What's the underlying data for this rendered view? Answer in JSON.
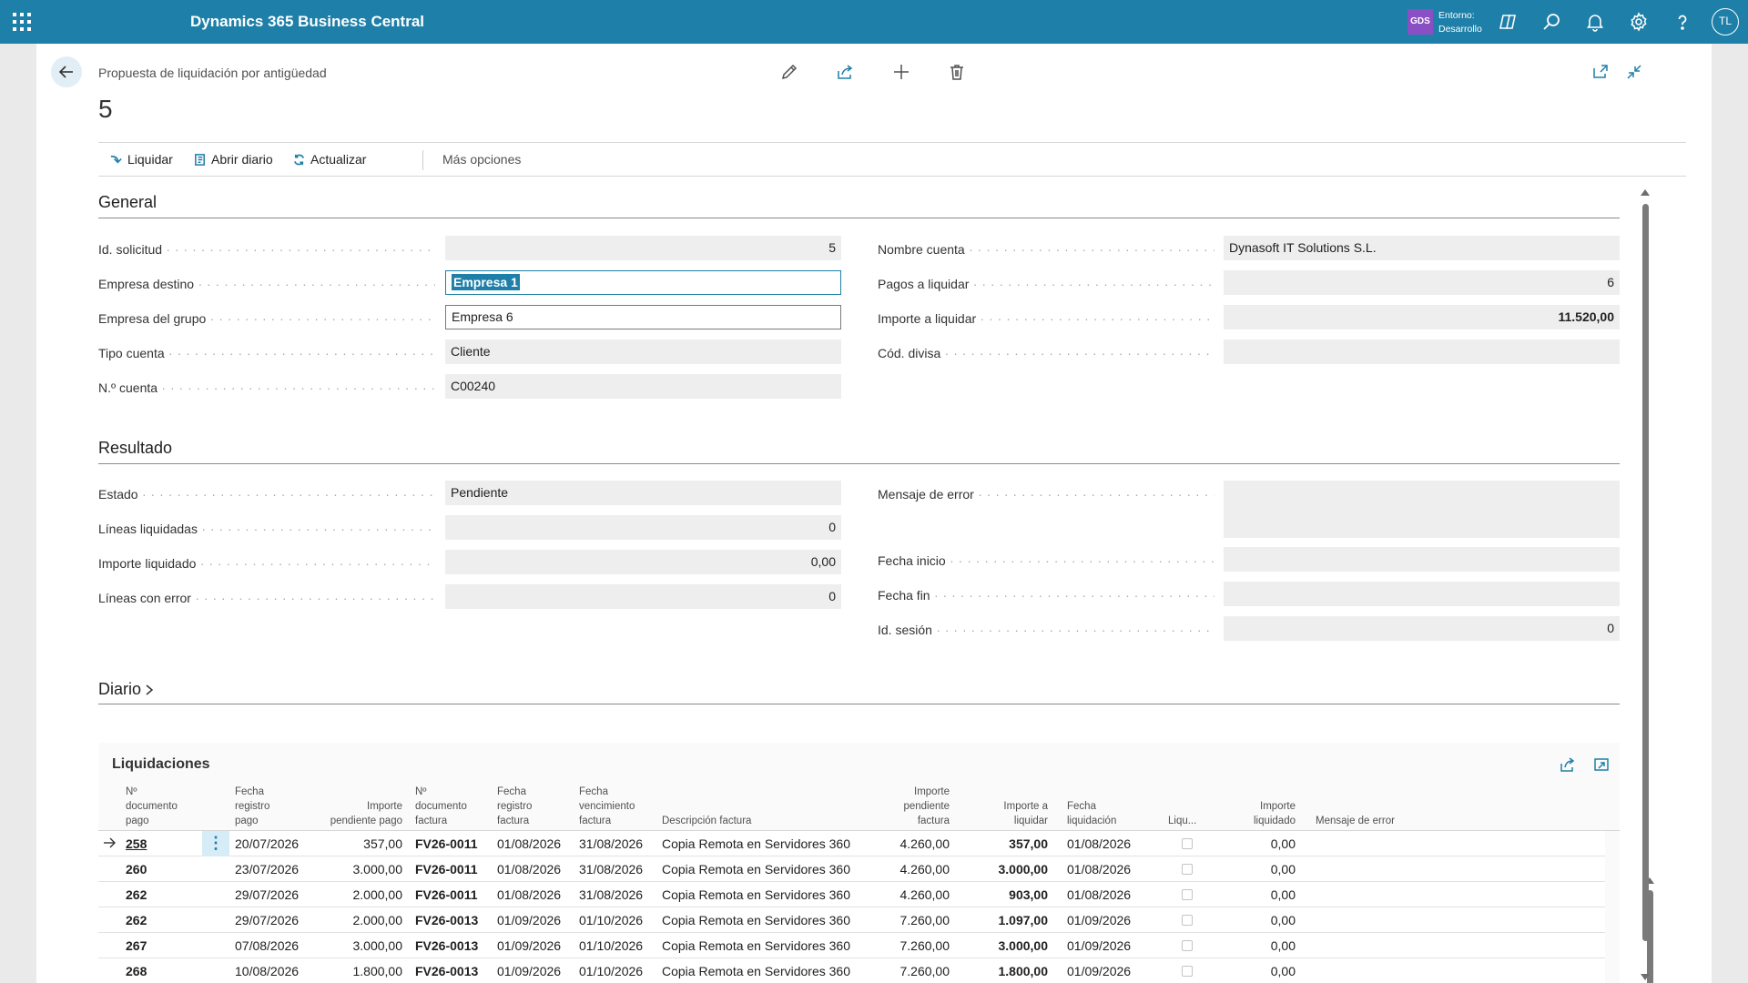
{
  "topbar": {
    "app_name": "Dynamics 365 Business Central",
    "env_badge": "GDS",
    "env_line1": "Entorno:",
    "env_line2": "Desarrollo",
    "user_initials": "TL"
  },
  "header": {
    "subtitle": "Propuesta de liquidación por antigüedad",
    "record_no": "5"
  },
  "actions": {
    "liquidar": "Liquidar",
    "abrir_diario": "Abrir diario",
    "actualizar": "Actualizar",
    "mas_opciones": "Más opciones"
  },
  "general": {
    "title": "General",
    "left": [
      {
        "label": "Id. solicitud",
        "value": "5"
      },
      {
        "label": "Empresa destino",
        "value": "Empresa 1"
      },
      {
        "label": "Empresa del grupo",
        "value": "Empresa 6"
      },
      {
        "label": "Tipo cuenta",
        "value": "Cliente"
      },
      {
        "label": "N.º cuenta",
        "value": "C00240"
      }
    ],
    "right": [
      {
        "label": "Nombre cuenta",
        "value": "Dynasoft IT Solutions S.L."
      },
      {
        "label": "Pagos a liquidar",
        "value": "6"
      },
      {
        "label": "Importe a liquidar",
        "value": "11.520,00"
      },
      {
        "label": "Cód. divisa",
        "value": ""
      }
    ]
  },
  "resultado": {
    "title": "Resultado",
    "left": [
      {
        "label": "Estado",
        "value": "Pendiente"
      },
      {
        "label": "Líneas liquidadas",
        "value": "0"
      },
      {
        "label": "Importe liquidado",
        "value": "0,00"
      },
      {
        "label": "Líneas con error",
        "value": "0"
      }
    ],
    "right": [
      {
        "label": "Mensaje de error",
        "value": ""
      },
      {
        "label": "Fecha inicio",
        "value": ""
      },
      {
        "label": "Fecha fin",
        "value": ""
      },
      {
        "label": "Id. sesión",
        "value": "0"
      }
    ]
  },
  "diario": {
    "title": "Diario"
  },
  "liquidaciones": {
    "title": "Liquidaciones",
    "columns": {
      "doc_pago": [
        "Nº",
        "documento",
        "pago"
      ],
      "fecha_reg_pago": [
        "Fecha",
        "registro",
        "pago"
      ],
      "importe_pend_pago": [
        "Importe",
        "pendiente pago"
      ],
      "doc_factura": [
        "Nº",
        "documento",
        "factura"
      ],
      "fecha_reg_factura": [
        "Fecha",
        "registro",
        "factura"
      ],
      "fecha_venc_factura": [
        "Fecha",
        "vencimiento",
        "factura"
      ],
      "descripcion": [
        "Descripción factura"
      ],
      "importe_pend_factura": [
        "Importe",
        "pendiente",
        "factura"
      ],
      "importe_liquidar": [
        "Importe a",
        "liquidar"
      ],
      "fecha_liquidacion": [
        "Fecha",
        "liquidación"
      ],
      "liquidado": [
        "Liqu..."
      ],
      "importe_liquidado": [
        "Importe",
        "liquidado"
      ],
      "mensaje_error": [
        "Mensaje de error"
      ]
    },
    "rows": [
      {
        "doc_pago": "258",
        "fecha_pago": "20/07/2026",
        "imp_pend_pago": "357,00",
        "doc_factura": "FV26-0011",
        "fecha_reg_fact": "01/08/2026",
        "fecha_venc_fact": "31/08/2026",
        "descripcion": "Copia Remota en Servidores 360",
        "imp_pend_fact": "4.260,00",
        "imp_liquidar": "357,00",
        "fecha_liq": "01/08/2026",
        "imp_liquidado": "0,00"
      },
      {
        "doc_pago": "260",
        "fecha_pago": "23/07/2026",
        "imp_pend_pago": "3.000,00",
        "doc_factura": "FV26-0011",
        "fecha_reg_fact": "01/08/2026",
        "fecha_venc_fact": "31/08/2026",
        "descripcion": "Copia Remota en Servidores 360",
        "imp_pend_fact": "4.260,00",
        "imp_liquidar": "3.000,00",
        "fecha_liq": "01/08/2026",
        "imp_liquidado": "0,00"
      },
      {
        "doc_pago": "262",
        "fecha_pago": "29/07/2026",
        "imp_pend_pago": "2.000,00",
        "doc_factura": "FV26-0011",
        "fecha_reg_fact": "01/08/2026",
        "fecha_venc_fact": "31/08/2026",
        "descripcion": "Copia Remota en Servidores 360",
        "imp_pend_fact": "4.260,00",
        "imp_liquidar": "903,00",
        "fecha_liq": "01/08/2026",
        "imp_liquidado": "0,00"
      },
      {
        "doc_pago": "262",
        "fecha_pago": "29/07/2026",
        "imp_pend_pago": "2.000,00",
        "doc_factura": "FV26-0013",
        "fecha_reg_fact": "01/09/2026",
        "fecha_venc_fact": "01/10/2026",
        "descripcion": "Copia Remota en Servidores 360",
        "imp_pend_fact": "7.260,00",
        "imp_liquidar": "1.097,00",
        "fecha_liq": "01/09/2026",
        "imp_liquidado": "0,00"
      },
      {
        "doc_pago": "267",
        "fecha_pago": "07/08/2026",
        "imp_pend_pago": "3.000,00",
        "doc_factura": "FV26-0013",
        "fecha_reg_fact": "01/09/2026",
        "fecha_venc_fact": "01/10/2026",
        "descripcion": "Copia Remota en Servidores 360",
        "imp_pend_fact": "7.260,00",
        "imp_liquidar": "3.000,00",
        "fecha_liq": "01/09/2026",
        "imp_liquidado": "0,00"
      },
      {
        "doc_pago": "268",
        "fecha_pago": "10/08/2026",
        "imp_pend_pago": "1.800,00",
        "doc_factura": "FV26-0013",
        "fecha_reg_fact": "01/09/2026",
        "fecha_venc_fact": "01/10/2026",
        "descripcion": "Copia Remota en Servidores 360",
        "imp_pend_fact": "7.260,00",
        "imp_liquidar": "1.800,00",
        "fecha_liq": "01/09/2026",
        "imp_liquidado": "0,00"
      }
    ]
  },
  "colors": {
    "topbar": "#1e7fa8",
    "env_badge": "#8a4fc4",
    "accent": "#1e7fa8"
  },
  "icons": [
    "app-launcher-icon",
    "copilot-icon",
    "search-icon",
    "bell-icon",
    "gear-icon",
    "help-icon",
    "back-arrow-icon",
    "edit-icon",
    "share-icon",
    "add-icon",
    "delete-icon",
    "open-new-window-icon",
    "collapse-icon",
    "liquidar-icon",
    "journal-icon",
    "refresh-icon",
    "chevron-right-icon",
    "row-arrow-icon",
    "row-menu-icon"
  ]
}
